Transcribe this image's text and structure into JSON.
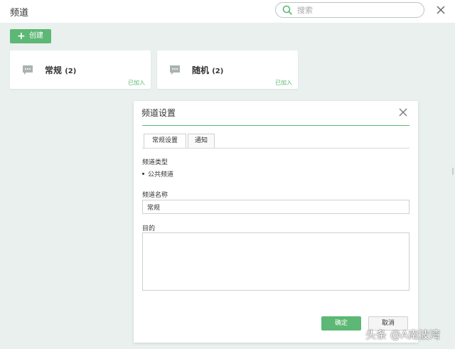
{
  "header": {
    "title": "频道",
    "search_placeholder": "搜索",
    "search_icon": "search-icon",
    "close_icon": "close-icon"
  },
  "toolbar": {
    "create_label": "创建"
  },
  "channels": [
    {
      "name": "常规",
      "count": "(2)",
      "status": "已加入",
      "icon": "chat-bubble-icon"
    },
    {
      "name": "随机",
      "count": "(2)",
      "status": "已加入",
      "icon": "chat-bubble-icon"
    }
  ],
  "dialog": {
    "title": "频道设置",
    "tabs": [
      {
        "label": "常规设置",
        "active": true
      },
      {
        "label": "通知",
        "active": false
      }
    ],
    "fields": {
      "type_label": "频道类型",
      "type_value": "公共频道",
      "name_label": "频道名称",
      "name_value": "常规",
      "purpose_label": "目的",
      "purpose_value": ""
    },
    "buttons": {
      "confirm": "确定",
      "cancel": "取消"
    }
  },
  "watermark": "头条 @A南波湾",
  "colors": {
    "accent": "#5cb874",
    "background": "#e9f0ee"
  }
}
